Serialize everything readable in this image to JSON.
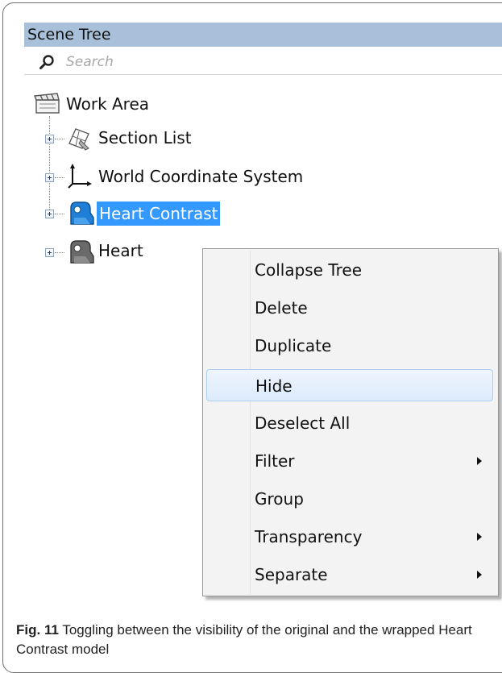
{
  "panel": {
    "title": "Scene Tree",
    "search_placeholder": "Search"
  },
  "tree": {
    "root": {
      "label": "Work Area",
      "icon": "clapperboard-icon"
    },
    "items": [
      {
        "label": "Section List",
        "icon": "section-plane-icon",
        "selected": false
      },
      {
        "label": "World Coordinate System",
        "icon": "axes-icon",
        "selected": false
      },
      {
        "label": "Heart Contrast",
        "icon": "model-icon",
        "selected": true
      },
      {
        "label": "Heart",
        "icon": "model-icon",
        "selected": false
      }
    ]
  },
  "context_menu": {
    "items": [
      {
        "label": "Collapse Tree",
        "submenu": false
      },
      {
        "label": "Delete",
        "submenu": false
      },
      {
        "label": "Duplicate",
        "submenu": false
      },
      {
        "label": "Hide",
        "submenu": false,
        "highlighted": true
      },
      {
        "label": "Deselect All",
        "submenu": false
      },
      {
        "label": "Filter",
        "submenu": true
      },
      {
        "label": "Group",
        "submenu": false
      },
      {
        "label": "Transparency",
        "submenu": true
      },
      {
        "label": "Separate",
        "submenu": true
      }
    ]
  },
  "caption": {
    "figure_label": "Fig. 11",
    "text": " Toggling between the visibility of the original and the wrapped Heart Contrast model"
  },
  "colors": {
    "title_bar": "#a8c0da",
    "selection": "#3399ff",
    "menu_background": "#f3f3f3",
    "menu_hover": "#dcebfc"
  }
}
